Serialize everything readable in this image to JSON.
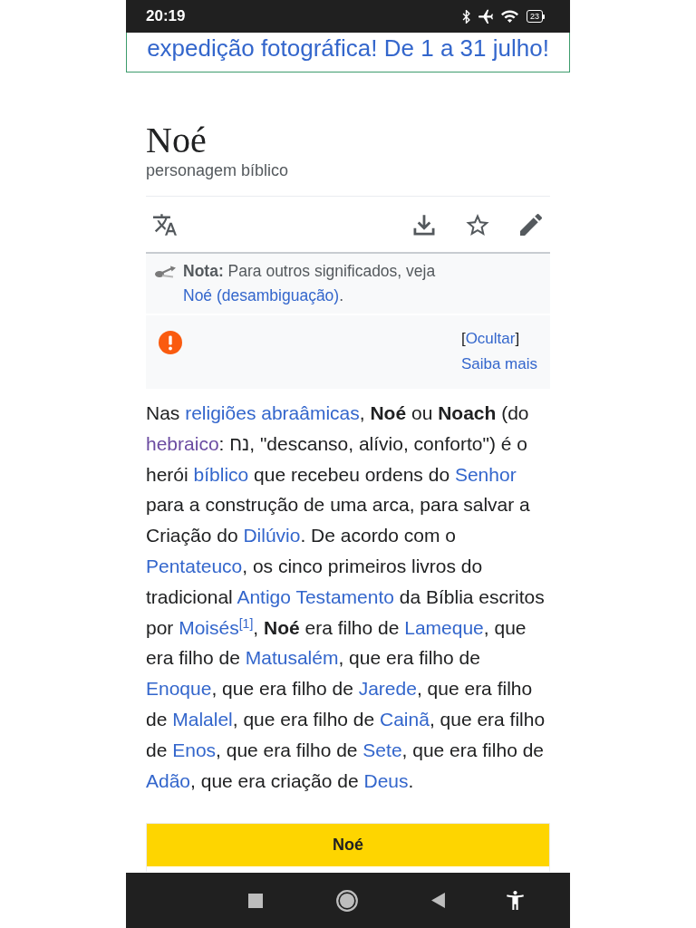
{
  "status_bar": {
    "time": "20:19",
    "icons": [
      {
        "kind": "bluetooth"
      },
      {
        "kind": "airplane"
      },
      {
        "kind": "wifi"
      }
    ],
    "battery": "23"
  },
  "banner": {
    "text": "expedição fotográfica! De 1 a 31 julho!"
  },
  "page": {
    "title": "Noé",
    "description": "personagem bíblico"
  },
  "toolbar": {
    "actions": [
      {
        "kind": "translate"
      },
      {
        "kind": "download"
      },
      {
        "kind": "star"
      },
      {
        "kind": "edit"
      }
    ]
  },
  "hatnote": {
    "text": "**Nota:** Para outros significados, veja ",
    "link": "Noé (desambiguação)",
    "end": "."
  },
  "issues": {
    "hide": {
      "open": "[",
      "label": "Ocultar",
      "close": "]"
    },
    "more": "Saiba mais"
  },
  "article": {
    "paragraph": [
      {
        "kind": "text",
        "text": "Nas "
      },
      {
        "kind": "link",
        "text": "religiões abraâmicas",
        "visited": false
      },
      {
        "kind": "text",
        "text": ", **Noé** ou **Noach** (do "
      },
      {
        "kind": "link",
        "text": "hebraico",
        "visited": true
      },
      {
        "kind": "text",
        "text": ": נח, \"descanso, alívio, conforto\") é o herói "
      },
      {
        "kind": "link",
        "text": "bíblico",
        "visited": false
      },
      {
        "kind": "text",
        "text": " que recebeu ordens do "
      },
      {
        "kind": "link",
        "text": "Senhor",
        "visited": false
      },
      {
        "kind": "text",
        "text": " para a construção de uma arca, para salvar a Criação do "
      },
      {
        "kind": "link",
        "text": "Dilúvio",
        "visited": false
      },
      {
        "kind": "text",
        "text": ". De acordo com o "
      },
      {
        "kind": "link",
        "text": "Pentateuco",
        "visited": false
      },
      {
        "kind": "text",
        "text": ", os cinco primeiros livros do tradicional "
      },
      {
        "kind": "link",
        "text": "Antigo Testamento",
        "visited": false
      },
      {
        "kind": "text",
        "text": " da Bíblia escritos por "
      },
      {
        "kind": "link",
        "text": "Moisés",
        "visited": false
      },
      {
        "kind": "ref",
        "text": "[1]"
      },
      {
        "kind": "text",
        "text": ", **Noé** era filho de "
      },
      {
        "kind": "link",
        "text": "Lameque",
        "visited": false
      },
      {
        "kind": "text",
        "text": ", que era filho de "
      },
      {
        "kind": "link",
        "text": "Matusalém",
        "visited": false
      },
      {
        "kind": "text",
        "text": ", que era filho de "
      },
      {
        "kind": "link",
        "text": "Enoque",
        "visited": false
      },
      {
        "kind": "text",
        "text": ", que era filho de "
      },
      {
        "kind": "link",
        "text": "Jarede",
        "visited": false
      },
      {
        "kind": "text",
        "text": ", que era filho de "
      },
      {
        "kind": "link",
        "text": "Malalel",
        "visited": false
      },
      {
        "kind": "text",
        "text": ", que era filho de "
      },
      {
        "kind": "link",
        "text": "Cainã",
        "visited": false
      },
      {
        "kind": "text",
        "text": ", que era filho de "
      },
      {
        "kind": "link",
        "text": "Enos",
        "visited": false
      },
      {
        "kind": "text",
        "text": ", que era filho de "
      },
      {
        "kind": "link",
        "text": "Sete",
        "visited": false
      },
      {
        "kind": "text",
        "text": ", que era filho de "
      },
      {
        "kind": "link",
        "text": "Adão",
        "visited": false
      },
      {
        "kind": "text",
        "text": ", que era criação de "
      },
      {
        "kind": "link",
        "text": "Deus",
        "visited": false
      },
      {
        "kind": "text",
        "text": "."
      }
    ]
  },
  "infobox": {
    "title": "Noé"
  },
  "nav_bar": {
    "buttons": [
      {
        "kind": "recents"
      },
      {
        "kind": "home"
      },
      {
        "kind": "back"
      },
      {
        "kind": "accessibility"
      }
    ]
  }
}
